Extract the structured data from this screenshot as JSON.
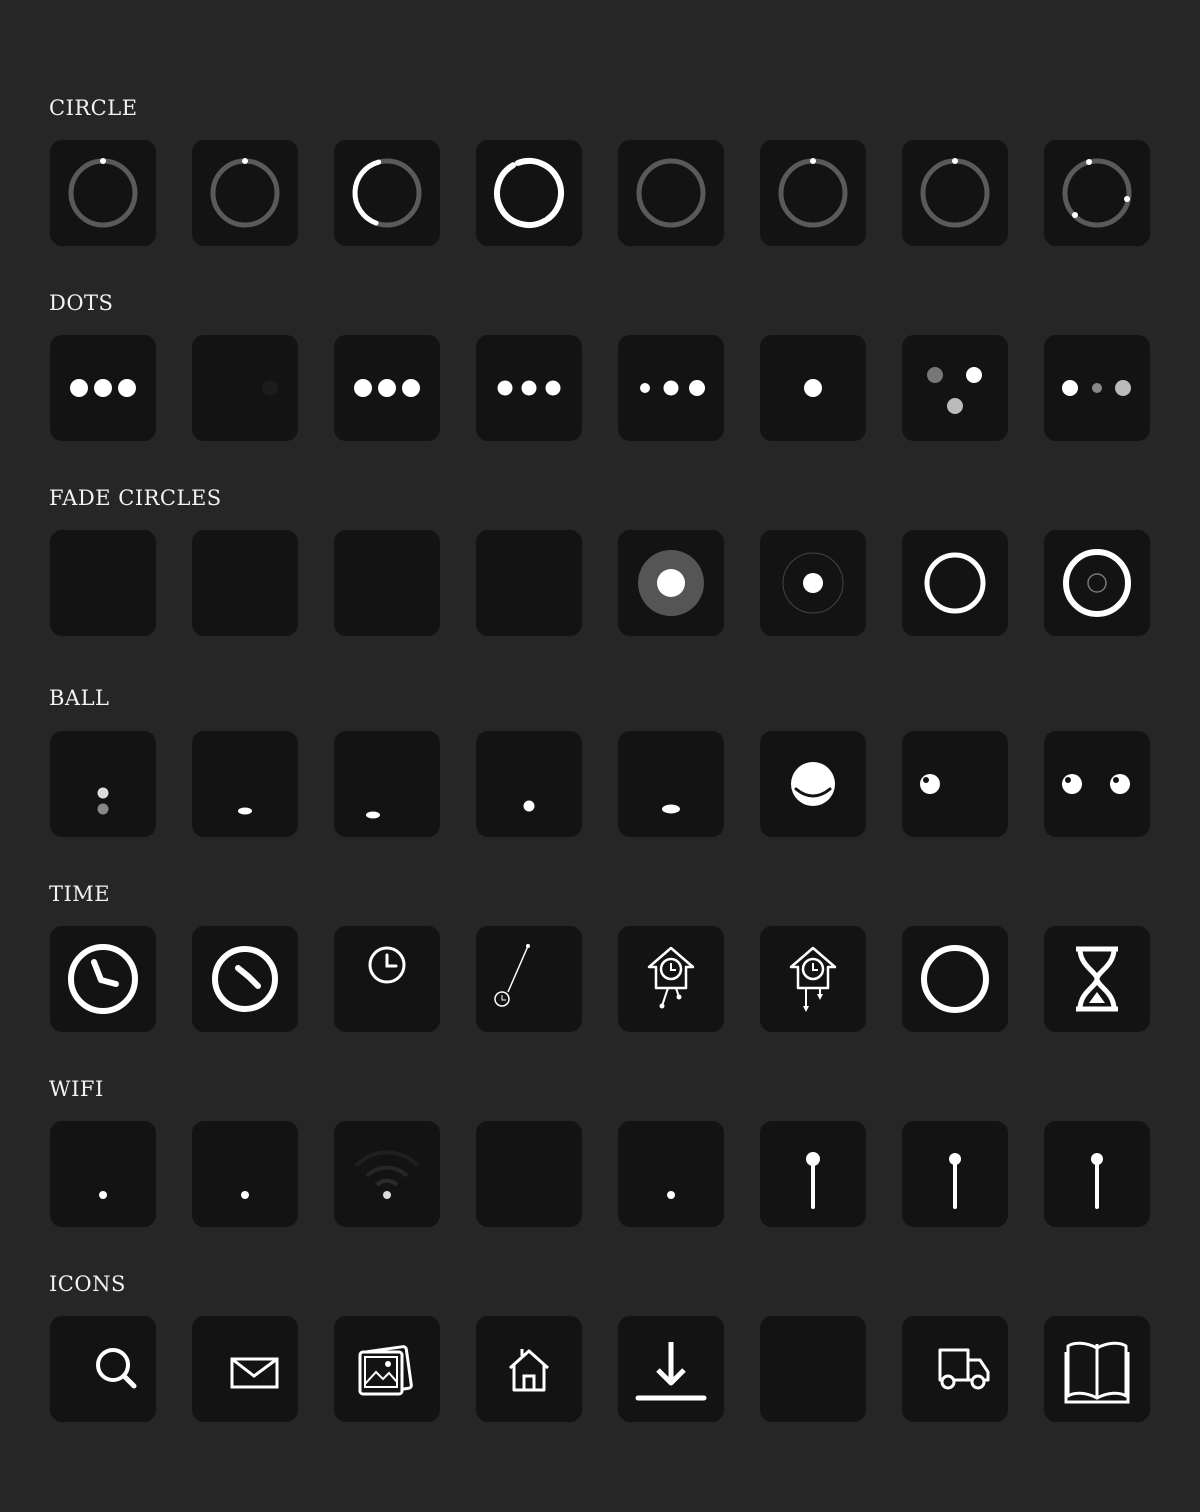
{
  "sections": [
    {
      "title": "CIRCLE",
      "items": [
        {
          "icon": "circle-spinner-icon"
        },
        {
          "icon": "circle-spinner-icon"
        },
        {
          "icon": "circle-arc-spinner-icon"
        },
        {
          "icon": "circle-arc-spinner-icon"
        },
        {
          "icon": "circle-ring-icon"
        },
        {
          "icon": "circle-spinner-icon"
        },
        {
          "icon": "circle-spinner-icon"
        },
        {
          "icon": "circle-orbit-dots-icon"
        }
      ]
    },
    {
      "title": "DOTS",
      "items": [
        {
          "icon": "three-dots-icon"
        },
        {
          "icon": "fading-dot-icon"
        },
        {
          "icon": "three-dots-icon"
        },
        {
          "icon": "three-dots-icon"
        },
        {
          "icon": "growing-dots-icon"
        },
        {
          "icon": "single-dot-icon"
        },
        {
          "icon": "triangle-dots-icon"
        },
        {
          "icon": "pulse-dots-icon"
        }
      ]
    },
    {
      "title": "FADE CIRCLES",
      "items": [
        {
          "icon": "blank-icon"
        },
        {
          "icon": "blank-icon"
        },
        {
          "icon": "blank-icon"
        },
        {
          "icon": "blank-icon"
        },
        {
          "icon": "glow-circle-icon"
        },
        {
          "icon": "target-circle-icon"
        },
        {
          "icon": "hollow-circle-icon"
        },
        {
          "icon": "double-ring-icon"
        }
      ]
    },
    {
      "title": "BALL",
      "items": [
        {
          "icon": "stacked-balls-icon"
        },
        {
          "icon": "squashed-ball-icon"
        },
        {
          "icon": "squashed-ball-icon"
        },
        {
          "icon": "small-ball-icon"
        },
        {
          "icon": "squashed-ball-icon"
        },
        {
          "icon": "smile-ball-icon"
        },
        {
          "icon": "shiny-ball-icon"
        },
        {
          "icon": "two-shiny-balls-icon"
        }
      ]
    },
    {
      "title": "TIME",
      "items": [
        {
          "icon": "clock-icon"
        },
        {
          "icon": "clock-icon"
        },
        {
          "icon": "small-clock-icon"
        },
        {
          "icon": "pendulum-icon"
        },
        {
          "icon": "cuckoo-clock-icon"
        },
        {
          "icon": "cuckoo-clock-icon"
        },
        {
          "icon": "ring-icon"
        },
        {
          "icon": "hourglass-icon"
        }
      ]
    },
    {
      "title": "WIFI",
      "items": [
        {
          "icon": "wifi-dot-icon"
        },
        {
          "icon": "wifi-dot-icon"
        },
        {
          "icon": "wifi-icon"
        },
        {
          "icon": "blank-icon"
        },
        {
          "icon": "wifi-dot-icon"
        },
        {
          "icon": "antenna-icon"
        },
        {
          "icon": "antenna-icon"
        },
        {
          "icon": "antenna-icon"
        }
      ]
    },
    {
      "title": "ICONS",
      "items": [
        {
          "icon": "search-icon"
        },
        {
          "icon": "mail-icon"
        },
        {
          "icon": "photos-icon"
        },
        {
          "icon": "home-icon"
        },
        {
          "icon": "download-icon"
        },
        {
          "icon": "blank-icon"
        },
        {
          "icon": "truck-icon"
        },
        {
          "icon": "book-icon"
        }
      ]
    }
  ],
  "colors": {
    "background": "#262626",
    "tile": "#131313",
    "glyph": "#ffffff",
    "track": "#5a5a5a"
  }
}
